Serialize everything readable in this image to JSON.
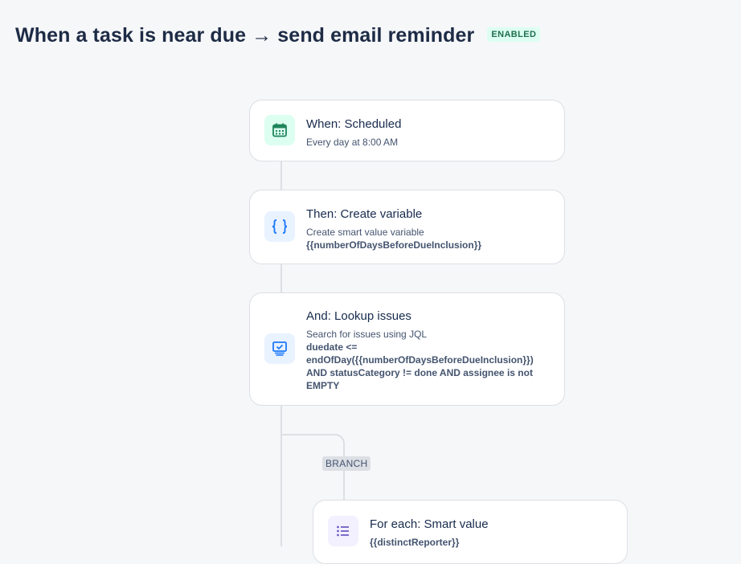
{
  "header": {
    "title": "When a task is near due → send email reminder",
    "status_badge": "ENABLED"
  },
  "colors": {
    "trigger_icon_bg": "#dcfff1",
    "trigger_icon": "#1f845a",
    "action_icon_bg": "#e9f2ff",
    "action_icon": "#1d7afc",
    "branch_icon_bg": "#f3f0ff",
    "branch_icon": "#6e5dc6"
  },
  "flow": {
    "trigger": {
      "icon": "calendar-icon",
      "label": "When: Scheduled",
      "description": "Every day at 8:00 AM"
    },
    "create_variable": {
      "icon": "braces-icon",
      "label": "Then: Create variable",
      "description": "Create smart value variable",
      "value": "{{numberOfDaysBeforeDueInclusion}}"
    },
    "lookup_issues": {
      "icon": "monitor-check-icon",
      "label": "And: Lookup issues",
      "description": "Search for issues using JQL",
      "value": "duedate <= endOfDay({{numberOfDaysBeforeDueInclusion}}) AND statusCategory != done AND assignee is not EMPTY"
    },
    "branch": {
      "tag": "BRANCH",
      "for_each": {
        "icon": "list-icon",
        "label": "For each: Smart value",
        "value": "{{distinctReporter}}"
      }
    }
  }
}
